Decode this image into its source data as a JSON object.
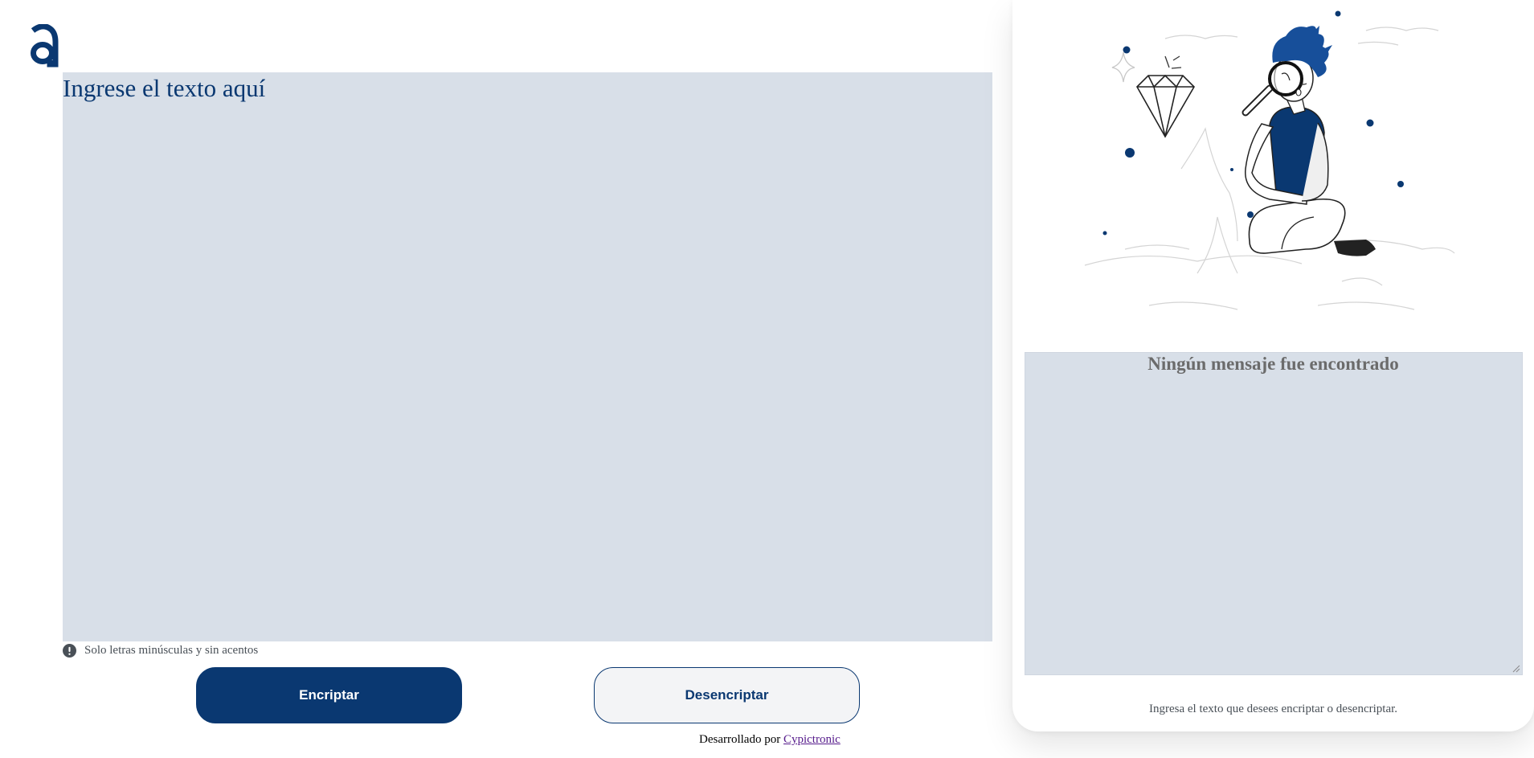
{
  "app": {
    "logo_icon": "alura-a-logo-icon",
    "accent_color": "#0a3871"
  },
  "input": {
    "placeholder": "Ingrese el texto aquí",
    "value": ""
  },
  "hint": {
    "icon": "exclamation-circle-icon",
    "text": "Solo letras minúsculas y sin acentos"
  },
  "buttons": {
    "encrypt_label": "Encriptar",
    "decrypt_label": "Desencriptar"
  },
  "footer": {
    "prefix": "Desarrollado por ",
    "link_text": "Cypictronic"
  },
  "output": {
    "illustration": "person-with-magnifying-glass-illustration",
    "title": "Ningún mensaje fue encontrado",
    "subtitle": "Ingresa el texto que desees encriptar o desencriptar."
  }
}
